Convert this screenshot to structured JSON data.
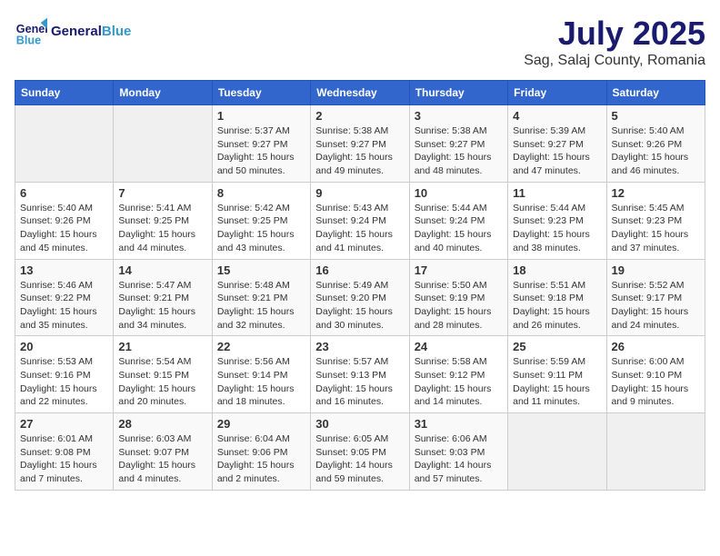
{
  "header": {
    "logo_general": "General",
    "logo_blue": "Blue",
    "title": "July 2025",
    "subtitle": "Sag, Salaj County, Romania"
  },
  "calendar": {
    "days_of_week": [
      "Sunday",
      "Monday",
      "Tuesday",
      "Wednesday",
      "Thursday",
      "Friday",
      "Saturday"
    ],
    "weeks": [
      [
        {
          "day": "",
          "info": ""
        },
        {
          "day": "",
          "info": ""
        },
        {
          "day": "1",
          "info": "Sunrise: 5:37 AM\nSunset: 9:27 PM\nDaylight: 15 hours\nand 50 minutes."
        },
        {
          "day": "2",
          "info": "Sunrise: 5:38 AM\nSunset: 9:27 PM\nDaylight: 15 hours\nand 49 minutes."
        },
        {
          "day": "3",
          "info": "Sunrise: 5:38 AM\nSunset: 9:27 PM\nDaylight: 15 hours\nand 48 minutes."
        },
        {
          "day": "4",
          "info": "Sunrise: 5:39 AM\nSunset: 9:27 PM\nDaylight: 15 hours\nand 47 minutes."
        },
        {
          "day": "5",
          "info": "Sunrise: 5:40 AM\nSunset: 9:26 PM\nDaylight: 15 hours\nand 46 minutes."
        }
      ],
      [
        {
          "day": "6",
          "info": "Sunrise: 5:40 AM\nSunset: 9:26 PM\nDaylight: 15 hours\nand 45 minutes."
        },
        {
          "day": "7",
          "info": "Sunrise: 5:41 AM\nSunset: 9:25 PM\nDaylight: 15 hours\nand 44 minutes."
        },
        {
          "day": "8",
          "info": "Sunrise: 5:42 AM\nSunset: 9:25 PM\nDaylight: 15 hours\nand 43 minutes."
        },
        {
          "day": "9",
          "info": "Sunrise: 5:43 AM\nSunset: 9:24 PM\nDaylight: 15 hours\nand 41 minutes."
        },
        {
          "day": "10",
          "info": "Sunrise: 5:44 AM\nSunset: 9:24 PM\nDaylight: 15 hours\nand 40 minutes."
        },
        {
          "day": "11",
          "info": "Sunrise: 5:44 AM\nSunset: 9:23 PM\nDaylight: 15 hours\nand 38 minutes."
        },
        {
          "day": "12",
          "info": "Sunrise: 5:45 AM\nSunset: 9:23 PM\nDaylight: 15 hours\nand 37 minutes."
        }
      ],
      [
        {
          "day": "13",
          "info": "Sunrise: 5:46 AM\nSunset: 9:22 PM\nDaylight: 15 hours\nand 35 minutes."
        },
        {
          "day": "14",
          "info": "Sunrise: 5:47 AM\nSunset: 9:21 PM\nDaylight: 15 hours\nand 34 minutes."
        },
        {
          "day": "15",
          "info": "Sunrise: 5:48 AM\nSunset: 9:21 PM\nDaylight: 15 hours\nand 32 minutes."
        },
        {
          "day": "16",
          "info": "Sunrise: 5:49 AM\nSunset: 9:20 PM\nDaylight: 15 hours\nand 30 minutes."
        },
        {
          "day": "17",
          "info": "Sunrise: 5:50 AM\nSunset: 9:19 PM\nDaylight: 15 hours\nand 28 minutes."
        },
        {
          "day": "18",
          "info": "Sunrise: 5:51 AM\nSunset: 9:18 PM\nDaylight: 15 hours\nand 26 minutes."
        },
        {
          "day": "19",
          "info": "Sunrise: 5:52 AM\nSunset: 9:17 PM\nDaylight: 15 hours\nand 24 minutes."
        }
      ],
      [
        {
          "day": "20",
          "info": "Sunrise: 5:53 AM\nSunset: 9:16 PM\nDaylight: 15 hours\nand 22 minutes."
        },
        {
          "day": "21",
          "info": "Sunrise: 5:54 AM\nSunset: 9:15 PM\nDaylight: 15 hours\nand 20 minutes."
        },
        {
          "day": "22",
          "info": "Sunrise: 5:56 AM\nSunset: 9:14 PM\nDaylight: 15 hours\nand 18 minutes."
        },
        {
          "day": "23",
          "info": "Sunrise: 5:57 AM\nSunset: 9:13 PM\nDaylight: 15 hours\nand 16 minutes."
        },
        {
          "day": "24",
          "info": "Sunrise: 5:58 AM\nSunset: 9:12 PM\nDaylight: 15 hours\nand 14 minutes."
        },
        {
          "day": "25",
          "info": "Sunrise: 5:59 AM\nSunset: 9:11 PM\nDaylight: 15 hours\nand 11 minutes."
        },
        {
          "day": "26",
          "info": "Sunrise: 6:00 AM\nSunset: 9:10 PM\nDaylight: 15 hours\nand 9 minutes."
        }
      ],
      [
        {
          "day": "27",
          "info": "Sunrise: 6:01 AM\nSunset: 9:08 PM\nDaylight: 15 hours\nand 7 minutes."
        },
        {
          "day": "28",
          "info": "Sunrise: 6:03 AM\nSunset: 9:07 PM\nDaylight: 15 hours\nand 4 minutes."
        },
        {
          "day": "29",
          "info": "Sunrise: 6:04 AM\nSunset: 9:06 PM\nDaylight: 15 hours\nand 2 minutes."
        },
        {
          "day": "30",
          "info": "Sunrise: 6:05 AM\nSunset: 9:05 PM\nDaylight: 14 hours\nand 59 minutes."
        },
        {
          "day": "31",
          "info": "Sunrise: 6:06 AM\nSunset: 9:03 PM\nDaylight: 14 hours\nand 57 minutes."
        },
        {
          "day": "",
          "info": ""
        },
        {
          "day": "",
          "info": ""
        }
      ]
    ]
  }
}
